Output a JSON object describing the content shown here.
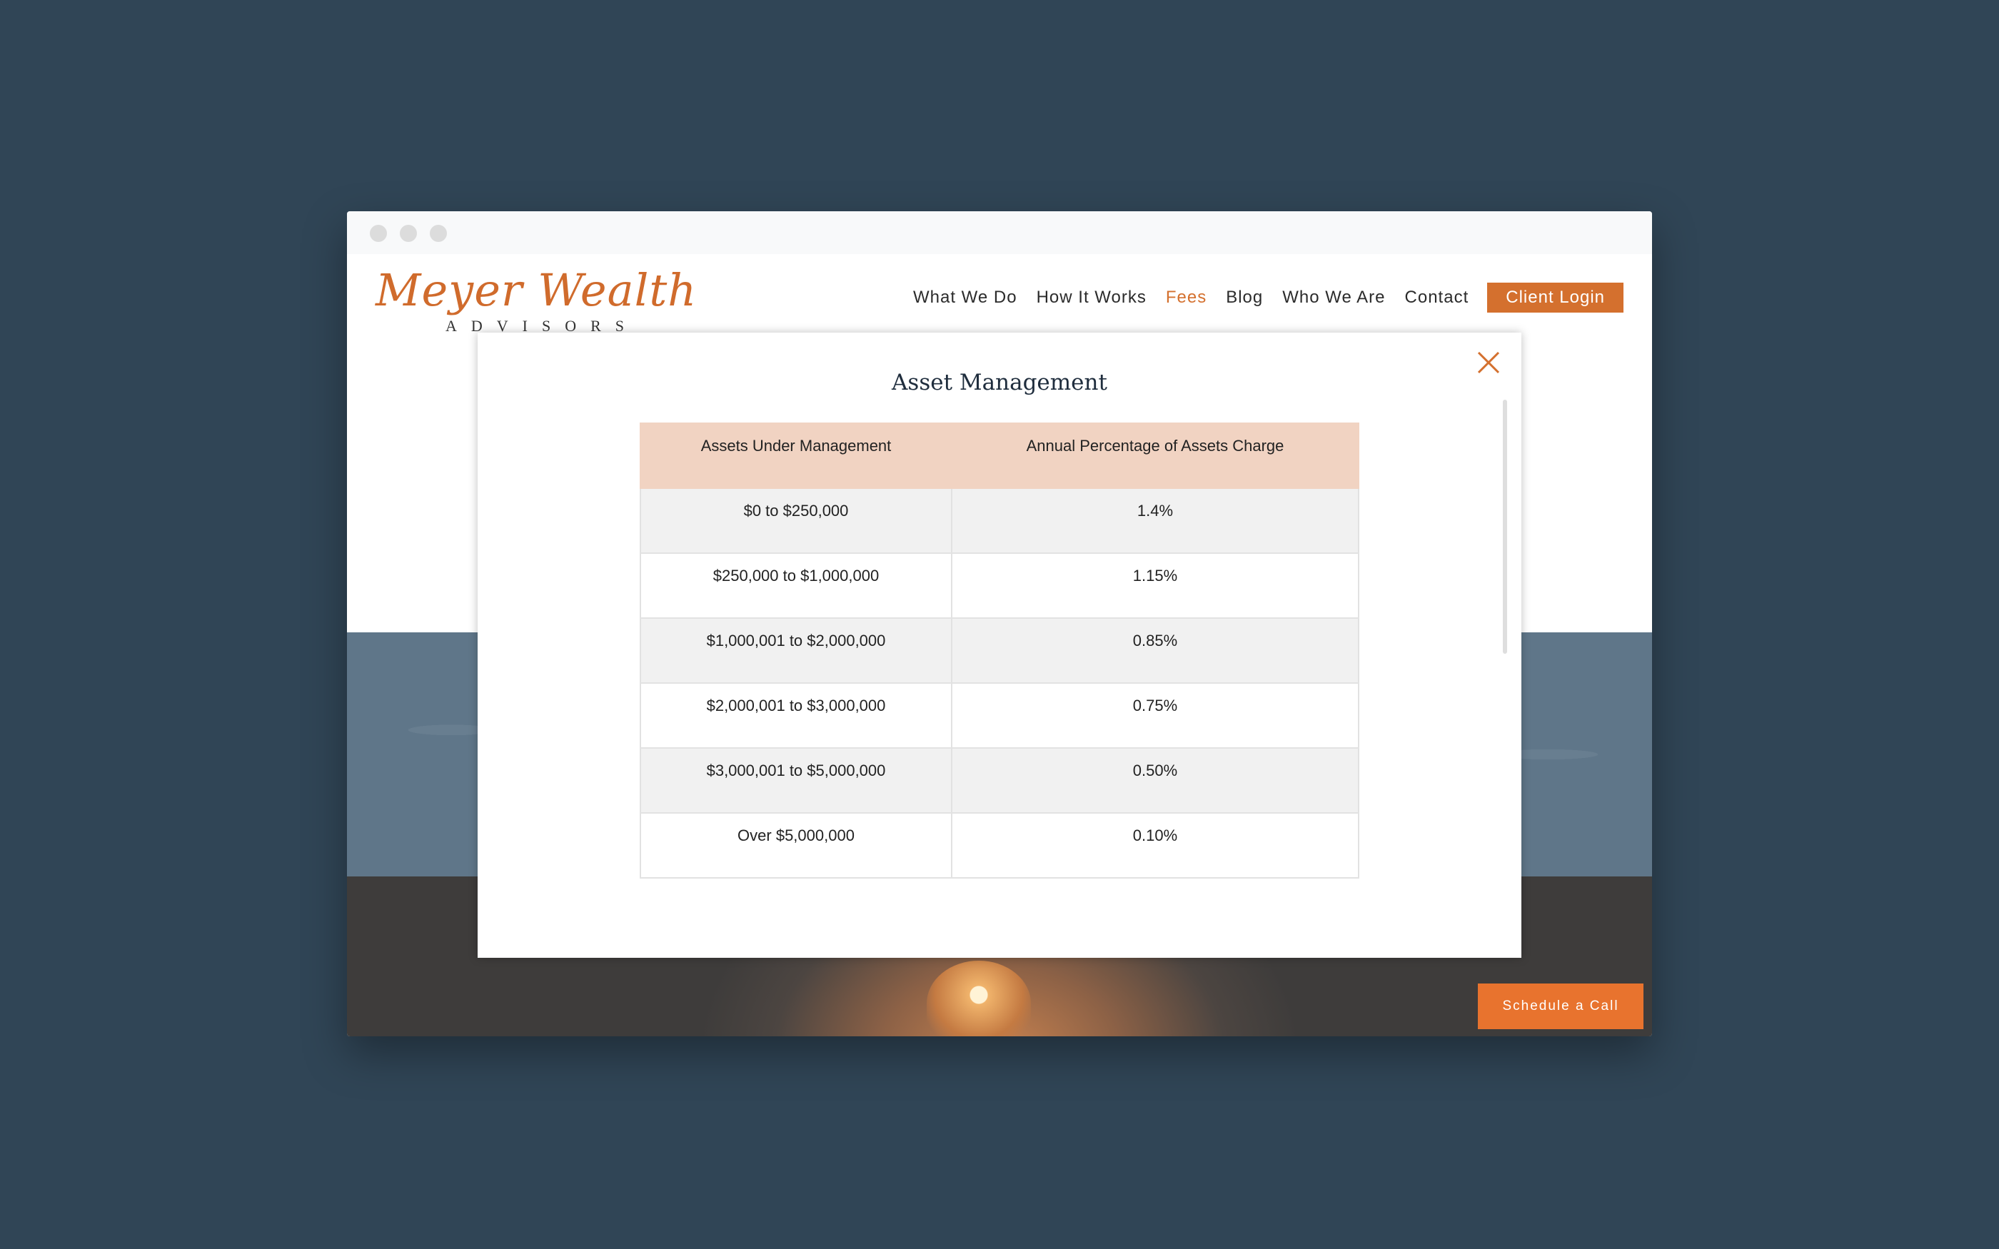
{
  "header": {
    "logo_script": "Meyer Wealth",
    "logo_sub": "ADVISORS",
    "brand_color": "#d4702e",
    "nav": [
      {
        "label": "What We Do"
      },
      {
        "label": "How It Works"
      },
      {
        "label": "Fees",
        "active": true
      },
      {
        "label": "Blog"
      },
      {
        "label": "Who We Are"
      },
      {
        "label": "Contact"
      }
    ],
    "login_label": "Client Login"
  },
  "modal": {
    "title": "Asset Management",
    "close_icon": "close-icon",
    "table": {
      "headers": [
        "Assets Under Management",
        "Annual Percentage of Assets Charge"
      ],
      "rows": [
        [
          "$0 to $250,000",
          "1.4%"
        ],
        [
          "$250,000 to $1,000,000",
          "1.15%"
        ],
        [
          "$1,000,001 to $2,000,000",
          "0.85%"
        ],
        [
          "$2,000,001 to $3,000,000",
          "0.75%"
        ],
        [
          "$3,000,001 to $5,000,000",
          "0.50%"
        ],
        [
          "Over $5,000,000",
          "0.10%"
        ]
      ]
    }
  },
  "schedule_label": "Schedule a Call"
}
